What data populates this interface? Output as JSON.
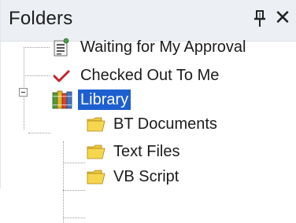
{
  "panel": {
    "title": "Folders",
    "pin_icon": "pin-icon",
    "close_glyph": "✕"
  },
  "tree": {
    "items": [
      {
        "label": "Waiting for My Approval",
        "icon": "approval-list-icon"
      },
      {
        "label": "Checked Out To Me",
        "icon": "checkmark-icon"
      },
      {
        "label": "Library",
        "icon": "library-books-icon",
        "expanded": true,
        "selected": true
      },
      {
        "label": "BT Documents",
        "icon": "folder-icon"
      },
      {
        "label": "Text Files",
        "icon": "folder-icon"
      },
      {
        "label": "VB Script",
        "icon": "folder-icon"
      }
    ]
  },
  "colors": {
    "title_bar": "#eceff4",
    "selection": "#1e5fd0",
    "folder": "#f5d74e",
    "check": "#c0262d"
  }
}
